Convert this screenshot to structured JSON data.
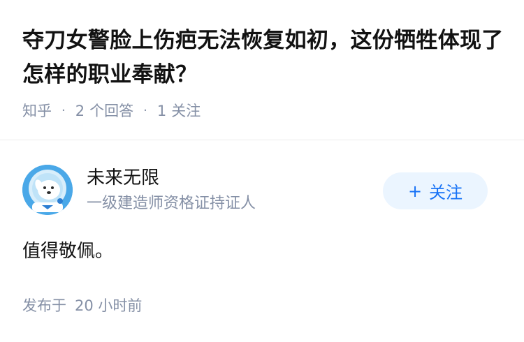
{
  "question": {
    "title": "夺刀女警脸上伤疤无法恢复如初，这份牺牲体现了怎样的职业奉献？",
    "source": "知乎",
    "answer_count": "2",
    "answer_label": "个回答",
    "follower_count": "1",
    "follower_label": "关注"
  },
  "answer": {
    "author": {
      "name": "未来无限",
      "badge": "一级建造师资格证持证人"
    },
    "follow_button": {
      "icon": "+",
      "label": "关注"
    },
    "content": "值得敬佩。",
    "published": {
      "prefix": "发布于",
      "time": "20 小时前"
    }
  },
  "colors": {
    "accent": "#1772f6",
    "follow_bg": "#ebf5ff",
    "muted": "#8590a6",
    "avatar_bg": "#48a9e6"
  }
}
